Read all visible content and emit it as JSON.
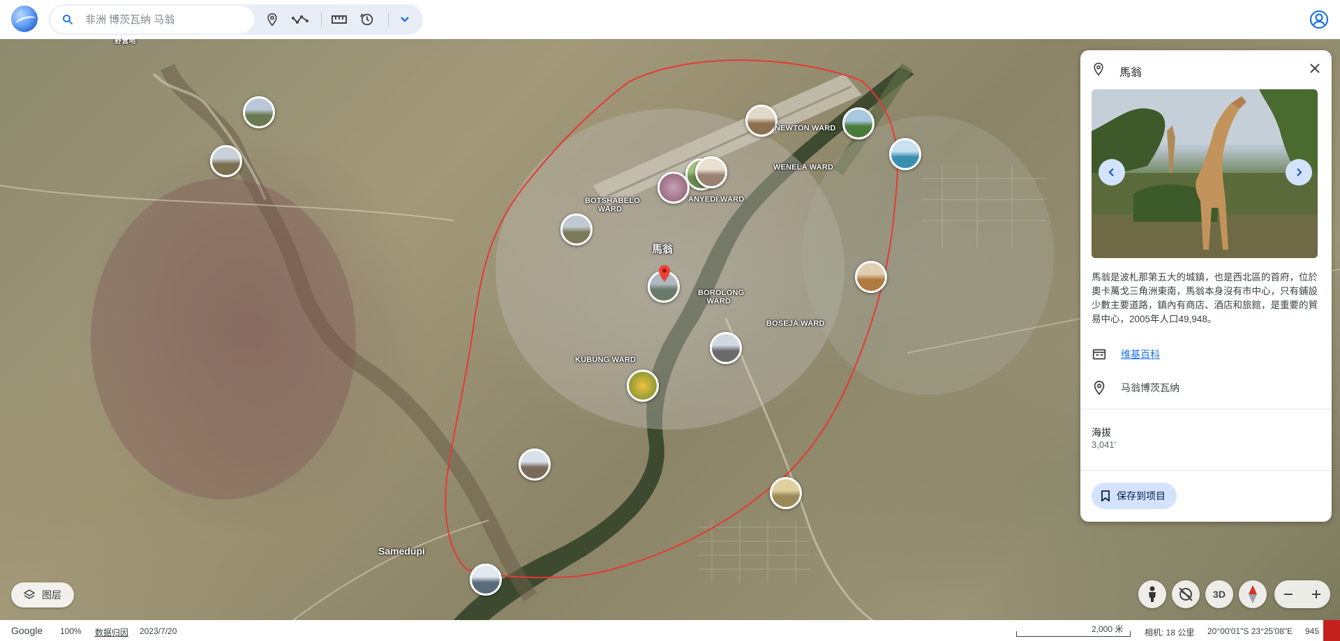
{
  "app": {
    "name": "Google Earth"
  },
  "search": {
    "placeholder": "非洲 博茨瓦纳 马翁"
  },
  "toolbar": {
    "icons": [
      "place-pin-icon",
      "path-icon",
      "ruler-icon",
      "history-icon",
      "chevron-down-icon"
    ]
  },
  "map": {
    "place_label": "馬翁",
    "town_label": "Samedupi",
    "wards": [
      {
        "name": "NEWTON WARD"
      },
      {
        "name": "WENELA WARD"
      },
      {
        "name": "BOTSHABELO WARD"
      },
      {
        "name": "SEDIA / MANYEDI WARD"
      },
      {
        "name": "BOROLONG WARD"
      },
      {
        "name": "BOSEJA WARD"
      },
      {
        "name": "KUBUNG WARD"
      }
    ],
    "top_left_label": "野营地",
    "photo_colors": [
      "#6b8aa0",
      "#7a8460",
      "#8b6f4e",
      "#4b7c8a",
      "#3a8fb0",
      "#8a5a6a",
      "#6a8a50",
      "#9a8070",
      "#b07a40",
      "#6a7a8a",
      "#8a9a60",
      "#c08a30",
      "#7a6a5a",
      "#9a8a5a",
      "#5a6a7a",
      "#6a7a7a"
    ]
  },
  "panel": {
    "title": "馬翁",
    "description": "馬翁是波札那第五大的城鎮，也是西北區的首府，位於奧卡萬戈三角洲東南，馬翁本身沒有市中心，只有鋪設少數主要道路，鎮內有商店、酒店和旅館，是重要的貿易中心，2005年人口49,948。",
    "wiki_link": "维基百科",
    "location": "马翁博茨瓦纳",
    "elevation_label": "海拔",
    "elevation_value": "3,041′",
    "save_button": "保存到项目"
  },
  "controls": {
    "layers_label": "图层",
    "btn_3d": "3D"
  },
  "status": {
    "brand": "Google",
    "zoom": "100%",
    "data_attribution": "数据归因",
    "date": "2023/7/20",
    "scale": "2,000 米",
    "camera": "相机:  18 公里",
    "coords": "20°00'01\"S 23°25'08\"E",
    "altitude": "945"
  },
  "colors": {
    "accent": "#1a73e8",
    "button_bg": "#d3e3fd",
    "boundary": "#e53935"
  }
}
